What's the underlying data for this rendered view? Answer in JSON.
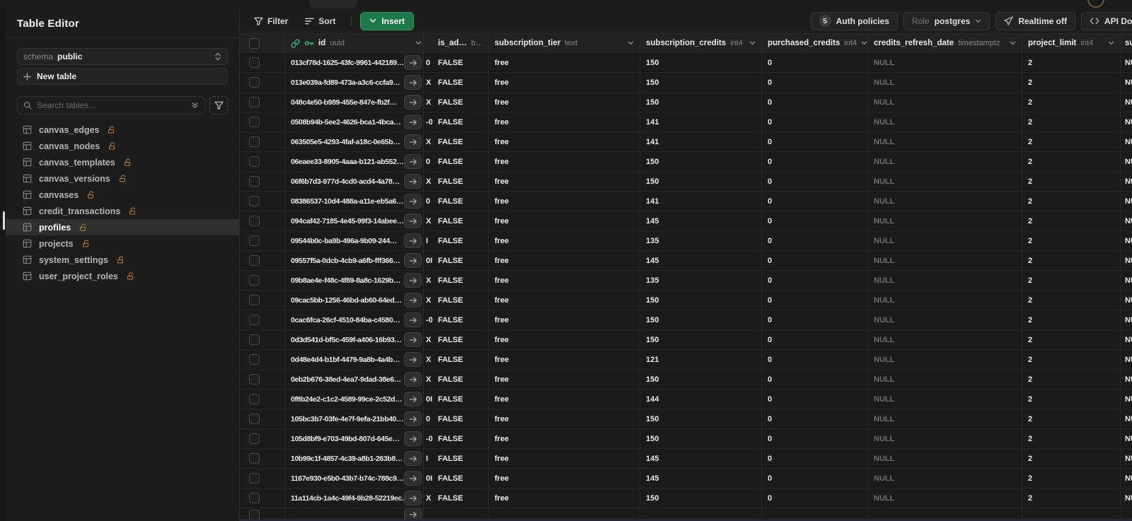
{
  "colors": {
    "accent_green": "#3ecf8e",
    "insert_button_green": "#1d7a48",
    "lock_orange": "#c28135",
    "null_text": "#6f6f6f",
    "selected_row_bg": "#2f2f2f"
  },
  "icons": {
    "filter": "funnel",
    "sort": "list-lines",
    "insert_chevron": "chevron-down",
    "realtime": "send-cursor",
    "api_docs": "code-brackets",
    "id_link": "chain-link",
    "id_key": "key",
    "table": "grid-table",
    "search": "magnifier",
    "locked": "open-padlock",
    "expand_row": "arrow-right"
  },
  "sidebar": {
    "title": "Table Editor",
    "schema_label": "schema",
    "schema_value": "public",
    "new_table_label": "New table",
    "search_placeholder": "Search tables...",
    "tables": [
      {
        "name": "canvas_edges",
        "selected": false,
        "locked": false
      },
      {
        "name": "canvas_nodes",
        "selected": false,
        "locked": false
      },
      {
        "name": "canvas_templates",
        "selected": false,
        "locked": false
      },
      {
        "name": "canvas_versions",
        "selected": false,
        "locked": false
      },
      {
        "name": "canvases",
        "selected": false,
        "locked": false
      },
      {
        "name": "credit_transactions",
        "selected": false,
        "locked": false
      },
      {
        "name": "profiles",
        "selected": true,
        "locked": false
      },
      {
        "name": "projects",
        "selected": false,
        "locked": false
      },
      {
        "name": "system_settings",
        "selected": false,
        "locked": true
      },
      {
        "name": "user_project_roles",
        "selected": false,
        "locked": false
      }
    ]
  },
  "toolbar": {
    "filter_label": "Filter",
    "sort_label": "Sort",
    "insert_label": "Insert",
    "auth_policies_count": "5",
    "auth_policies_label": "Auth policies",
    "role_label": "Role",
    "role_value": "postgres",
    "realtime_label": "Realtime off",
    "api_docs_label": "API Do"
  },
  "grid": {
    "columns": [
      {
        "name": "id",
        "type": "uuid"
      },
      {
        "name": "",
        "type": ""
      },
      {
        "name": "is_ad…",
        "type": "b…"
      },
      {
        "name": "subscription_tier",
        "type": "text"
      },
      {
        "name": "subscription_credits",
        "type": "int4"
      },
      {
        "name": "purchased_credits",
        "type": "int4"
      },
      {
        "name": "credits_refresh_date",
        "type": "timestamptz"
      },
      {
        "name": "project_limit",
        "type": "int4"
      },
      {
        "name": "su",
        "type": ""
      }
    ],
    "rows": [
      {
        "id": "013cf78d-1625-43fc-9961-442189…",
        "clip": "0",
        "is_admin": "FALSE",
        "tier": "free",
        "sub_credits": "150",
        "purchased": "0",
        "refresh": "NULL",
        "limit": "2",
        "last": "NU"
      },
      {
        "id": "013e039a-fd89-473a-a3c6-ccfa9…",
        "clip": "X",
        "is_admin": "FALSE",
        "tier": "free",
        "sub_credits": "150",
        "purchased": "0",
        "refresh": "NULL",
        "limit": "2",
        "last": "NU"
      },
      {
        "id": "048c4e50-b989-455e-847e-fb2f…",
        "clip": "X",
        "is_admin": "FALSE",
        "tier": "free",
        "sub_credits": "150",
        "purchased": "0",
        "refresh": "NULL",
        "limit": "2",
        "last": "NU"
      },
      {
        "id": "0508b94b-5ee2-4626-bca1-4bca…",
        "clip": "-0",
        "is_admin": "FALSE",
        "tier": "free",
        "sub_credits": "141",
        "purchased": "0",
        "refresh": "NULL",
        "limit": "2",
        "last": "NU"
      },
      {
        "id": "063505e5-4293-4faf-a18c-0e65b…",
        "clip": "X",
        "is_admin": "FALSE",
        "tier": "free",
        "sub_credits": "141",
        "purchased": "0",
        "refresh": "NULL",
        "limit": "2",
        "last": "NU"
      },
      {
        "id": "06eaee33-8905-4aaa-b121-ab552…",
        "clip": "0",
        "is_admin": "FALSE",
        "tier": "free",
        "sub_credits": "150",
        "purchased": "0",
        "refresh": "NULL",
        "limit": "2",
        "last": "NU"
      },
      {
        "id": "06f6b7d3-977d-4cd0-acd4-4a78…",
        "clip": "X",
        "is_admin": "FALSE",
        "tier": "free",
        "sub_credits": "150",
        "purchased": "0",
        "refresh": "NULL",
        "limit": "2",
        "last": "NU"
      },
      {
        "id": "08386537-10d4-488a-a11e-eb5a6…",
        "clip": "0",
        "is_admin": "FALSE",
        "tier": "free",
        "sub_credits": "141",
        "purchased": "0",
        "refresh": "NULL",
        "limit": "2",
        "last": "NU"
      },
      {
        "id": "094caf42-7185-4e45-99f3-14abee…",
        "clip": "X",
        "is_admin": "FALSE",
        "tier": "free",
        "sub_credits": "145",
        "purchased": "0",
        "refresh": "NULL",
        "limit": "2",
        "last": "NU"
      },
      {
        "id": "09544b0c-ba9b-496a-9b09-244…",
        "clip": "I",
        "is_admin": "FALSE",
        "tier": "free",
        "sub_credits": "135",
        "purchased": "0",
        "refresh": "NULL",
        "limit": "2",
        "last": "NU"
      },
      {
        "id": "09557f5a-0dcb-4cb9-a6fb-fff366…",
        "clip": "0I",
        "is_admin": "FALSE",
        "tier": "free",
        "sub_credits": "145",
        "purchased": "0",
        "refresh": "NULL",
        "limit": "2",
        "last": "NU"
      },
      {
        "id": "09b8ae4e-f48c-4f89-8a8c-1629b…",
        "clip": "X",
        "is_admin": "FALSE",
        "tier": "free",
        "sub_credits": "135",
        "purchased": "0",
        "refresh": "NULL",
        "limit": "2",
        "last": "NU"
      },
      {
        "id": "09cac5bb-1256-46bd-ab60-64ed…",
        "clip": "X",
        "is_admin": "FALSE",
        "tier": "free",
        "sub_credits": "150",
        "purchased": "0",
        "refresh": "NULL",
        "limit": "2",
        "last": "NU"
      },
      {
        "id": "0cac6fca-26cf-4510-84ba-c4580…",
        "clip": "-0",
        "is_admin": "FALSE",
        "tier": "free",
        "sub_credits": "150",
        "purchased": "0",
        "refresh": "NULL",
        "limit": "2",
        "last": "NU"
      },
      {
        "id": "0d3d541d-bf5c-459f-a406-16b93…",
        "clip": "X",
        "is_admin": "FALSE",
        "tier": "free",
        "sub_credits": "150",
        "purchased": "0",
        "refresh": "NULL",
        "limit": "2",
        "last": "NU"
      },
      {
        "id": "0d48e4d4-b1bf-4479-9a8b-4a4b…",
        "clip": "X",
        "is_admin": "FALSE",
        "tier": "free",
        "sub_credits": "121",
        "purchased": "0",
        "refresh": "NULL",
        "limit": "2",
        "last": "NU"
      },
      {
        "id": "0eb2b676-38ed-4ea7-9dad-38e6…",
        "clip": "X",
        "is_admin": "FALSE",
        "tier": "free",
        "sub_credits": "150",
        "purchased": "0",
        "refresh": "NULL",
        "limit": "2",
        "last": "NU"
      },
      {
        "id": "0f8b24e2-c1c2-4589-99ce-2c52d…",
        "clip": "0I",
        "is_admin": "FALSE",
        "tier": "free",
        "sub_credits": "144",
        "purchased": "0",
        "refresh": "NULL",
        "limit": "2",
        "last": "NU"
      },
      {
        "id": "105bc3b7-03fe-4e7f-9efa-21bb40…",
        "clip": "0",
        "is_admin": "FALSE",
        "tier": "free",
        "sub_credits": "150",
        "purchased": "0",
        "refresh": "NULL",
        "limit": "2",
        "last": "NU"
      },
      {
        "id": "105d8bf9-e703-49bd-807d-645e…",
        "clip": "-0",
        "is_admin": "FALSE",
        "tier": "free",
        "sub_credits": "150",
        "purchased": "0",
        "refresh": "NULL",
        "limit": "2",
        "last": "NU"
      },
      {
        "id": "10b99c1f-4857-4c39-a8b1-263b8…",
        "clip": "I",
        "is_admin": "FALSE",
        "tier": "free",
        "sub_credits": "145",
        "purchased": "0",
        "refresh": "NULL",
        "limit": "2",
        "last": "NU"
      },
      {
        "id": "1167e930-e5b0-43b7-b74c-788c9…",
        "clip": "0I",
        "is_admin": "FALSE",
        "tier": "free",
        "sub_credits": "145",
        "purchased": "0",
        "refresh": "NULL",
        "limit": "2",
        "last": "NU"
      },
      {
        "id": "11a114cb-1a4c-49f4-9b28-52219ec…",
        "clip": "X",
        "is_admin": "FALSE",
        "tier": "free",
        "sub_credits": "150",
        "purchased": "0",
        "refresh": "NULL",
        "limit": "2",
        "last": "NU"
      }
    ],
    "partial_row_visible": true
  }
}
